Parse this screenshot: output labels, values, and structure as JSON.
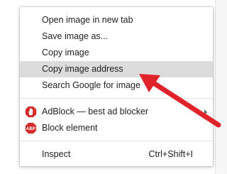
{
  "context_menu": {
    "items": [
      {
        "label": "Open image in new tab"
      },
      {
        "label": "Save image as..."
      },
      {
        "label": "Copy image"
      },
      {
        "label": "Copy image address"
      },
      {
        "label": "Search Google for image"
      }
    ],
    "extensions": [
      {
        "label": "AdBlock — best ad blocker",
        "icon": "adblock-hand-icon",
        "has_submenu": true
      },
      {
        "label": "Block element",
        "icon": "abp-icon",
        "icon_text": "ABP"
      }
    ],
    "inspect": {
      "label": "Inspect",
      "shortcut": "Ctrl+Shift+I"
    },
    "highlighted_item": "Copy image address"
  },
  "colors": {
    "highlight": "#dcdcdc",
    "arrow": "#e0232a",
    "adblock_red": "#d62b2b"
  }
}
